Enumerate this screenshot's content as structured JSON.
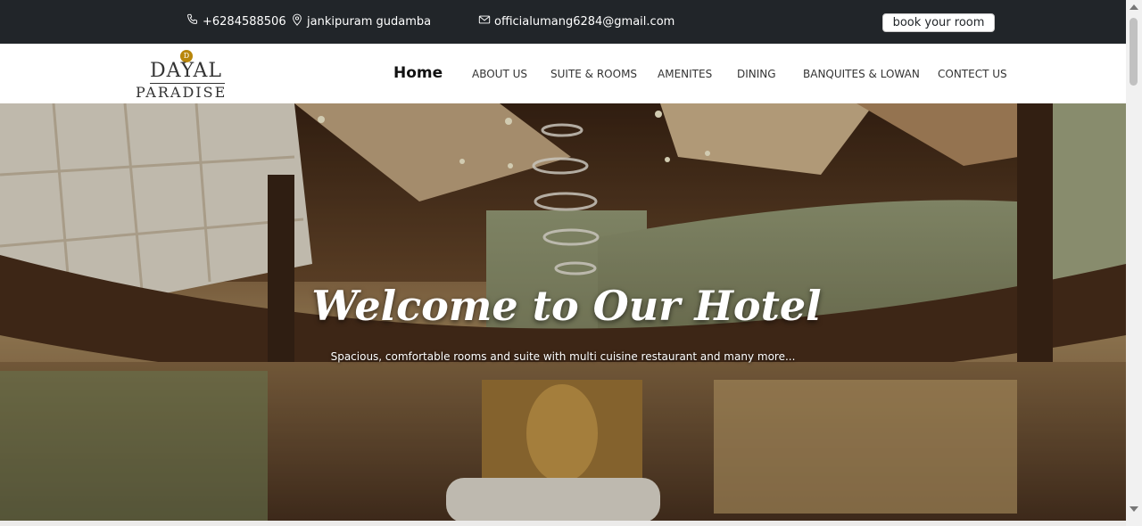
{
  "topbar": {
    "phone": "+6284588506",
    "location": "jankipuram gudamba",
    "email": "officialumang6284@gmail.com",
    "book_button": "book your room"
  },
  "logo": {
    "mark": "D",
    "line1": "DAYAL",
    "line2": "PARADISE"
  },
  "nav": {
    "items": [
      {
        "label": "Home"
      },
      {
        "label": "ABOUT US"
      },
      {
        "label": "SUITE & ROOMS"
      },
      {
        "label": "AMENITES"
      },
      {
        "label": "DINING"
      },
      {
        "label": "BANQUITES & LOWAN"
      },
      {
        "label": "CONTECT US"
      }
    ]
  },
  "hero": {
    "title": "Welcome to Our Hotel",
    "subtitle": "Spacious, comfortable rooms and suite with multi cuisine restaurant and many more..."
  },
  "colors": {
    "topbar_bg": "#212529",
    "accent_gold": "#b8860b"
  }
}
